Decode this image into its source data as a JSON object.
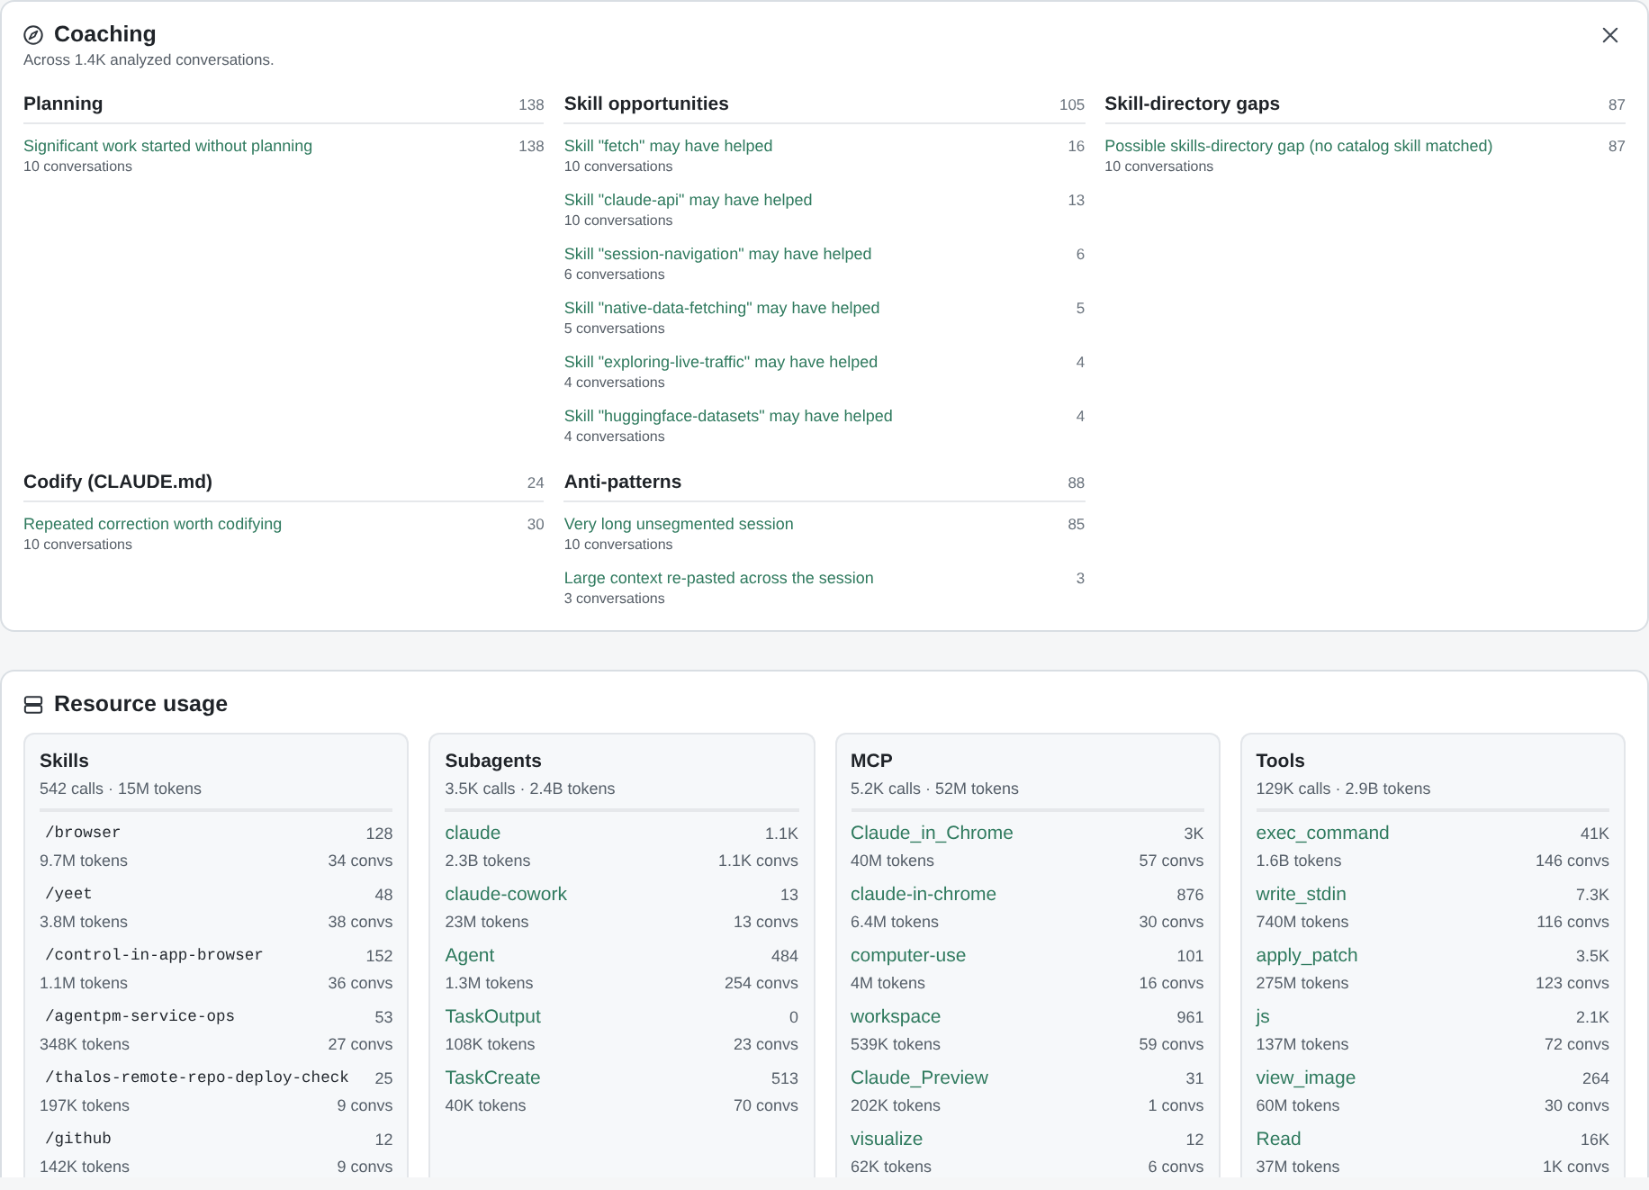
{
  "coaching": {
    "title": "Coaching",
    "subtitle": "Across 1.4K analyzed conversations.",
    "sections": [
      {
        "title": "Planning",
        "count": "138",
        "items": [
          {
            "label": "Significant work started without planning",
            "count": "138",
            "detail": "10 conversations"
          }
        ]
      },
      {
        "title": "Skill opportunities",
        "count": "105",
        "items": [
          {
            "label": "Skill \"fetch\" may have helped",
            "count": "16",
            "detail": "10 conversations"
          },
          {
            "label": "Skill \"claude-api\" may have helped",
            "count": "13",
            "detail": "10 conversations"
          },
          {
            "label": "Skill \"session-navigation\" may have helped",
            "count": "6",
            "detail": "6 conversations"
          },
          {
            "label": "Skill \"native-data-fetching\" may have helped",
            "count": "5",
            "detail": "5 conversations"
          },
          {
            "label": "Skill \"exploring-live-traffic\" may have helped",
            "count": "4",
            "detail": "4 conversations"
          },
          {
            "label": "Skill \"huggingface-datasets\" may have helped",
            "count": "4",
            "detail": "4 conversations"
          }
        ]
      },
      {
        "title": "Skill-directory gaps",
        "count": "87",
        "items": [
          {
            "label": "Possible skills-directory gap (no catalog skill matched)",
            "count": "87",
            "detail": "10 conversations"
          }
        ]
      },
      {
        "title": "Codify (CLAUDE.md)",
        "count": "24",
        "items": [
          {
            "label": "Repeated correction worth codifying",
            "count": "30",
            "detail": "10 conversations"
          }
        ]
      },
      {
        "title": "Anti-patterns",
        "count": "88",
        "items": [
          {
            "label": "Very long unsegmented session",
            "count": "85",
            "detail": "10 conversations"
          },
          {
            "label": "Large context re-pasted across the session",
            "count": "3",
            "detail": "3 conversations"
          }
        ]
      }
    ]
  },
  "resource_usage": {
    "title": "Resource usage",
    "groups": [
      {
        "title": "Skills",
        "summary": "542 calls · 15M tokens",
        "kind": "command",
        "entries": [
          {
            "name": "/browser",
            "calls": "128",
            "tokens": "9.7M tokens",
            "convs": "34 convs"
          },
          {
            "name": "/yeet",
            "calls": "48",
            "tokens": "3.8M tokens",
            "convs": "38 convs"
          },
          {
            "name": "/control-in-app-browser",
            "calls": "152",
            "tokens": "1.1M tokens",
            "convs": "36 convs"
          },
          {
            "name": "/agentpm-service-ops",
            "calls": "53",
            "tokens": "348K tokens",
            "convs": "27 convs"
          },
          {
            "name": "/thalos-remote-repo-deploy-check",
            "calls": "25",
            "tokens": "197K tokens",
            "convs": "9 convs"
          },
          {
            "name": "/github",
            "calls": "12",
            "tokens": "142K tokens",
            "convs": "9 convs"
          }
        ]
      },
      {
        "title": "Subagents",
        "summary": "3.5K calls · 2.4B tokens",
        "kind": "name",
        "entries": [
          {
            "name": "claude",
            "calls": "1.1K",
            "tokens": "2.3B tokens",
            "convs": "1.1K convs"
          },
          {
            "name": "claude-cowork",
            "calls": "13",
            "tokens": "23M tokens",
            "convs": "13 convs"
          },
          {
            "name": "Agent",
            "calls": "484",
            "tokens": "1.3M tokens",
            "convs": "254 convs"
          },
          {
            "name": "TaskOutput",
            "calls": "0",
            "tokens": "108K tokens",
            "convs": "23 convs"
          },
          {
            "name": "TaskCreate",
            "calls": "513",
            "tokens": "40K tokens",
            "convs": "70 convs"
          }
        ]
      },
      {
        "title": "MCP",
        "summary": "5.2K calls · 52M tokens",
        "kind": "name",
        "entries": [
          {
            "name": "Claude_in_Chrome",
            "calls": "3K",
            "tokens": "40M tokens",
            "convs": "57 convs"
          },
          {
            "name": "claude-in-chrome",
            "calls": "876",
            "tokens": "6.4M tokens",
            "convs": "30 convs"
          },
          {
            "name": "computer-use",
            "calls": "101",
            "tokens": "4M tokens",
            "convs": "16 convs"
          },
          {
            "name": "workspace",
            "calls": "961",
            "tokens": "539K tokens",
            "convs": "59 convs"
          },
          {
            "name": "Claude_Preview",
            "calls": "31",
            "tokens": "202K tokens",
            "convs": "1 convs"
          },
          {
            "name": "visualize",
            "calls": "12",
            "tokens": "62K tokens",
            "convs": "6 convs"
          }
        ]
      },
      {
        "title": "Tools",
        "summary": "129K calls · 2.9B tokens",
        "kind": "name",
        "entries": [
          {
            "name": "exec_command",
            "calls": "41K",
            "tokens": "1.6B tokens",
            "convs": "146 convs"
          },
          {
            "name": "write_stdin",
            "calls": "7.3K",
            "tokens": "740M tokens",
            "convs": "116 convs"
          },
          {
            "name": "apply_patch",
            "calls": "3.5K",
            "tokens": "275M tokens",
            "convs": "123 convs"
          },
          {
            "name": "js",
            "calls": "2.1K",
            "tokens": "137M tokens",
            "convs": "72 convs"
          },
          {
            "name": "view_image",
            "calls": "264",
            "tokens": "60M tokens",
            "convs": "30 convs"
          },
          {
            "name": "Read",
            "calls": "16K",
            "tokens": "37M tokens",
            "convs": "1K convs"
          }
        ]
      }
    ]
  }
}
